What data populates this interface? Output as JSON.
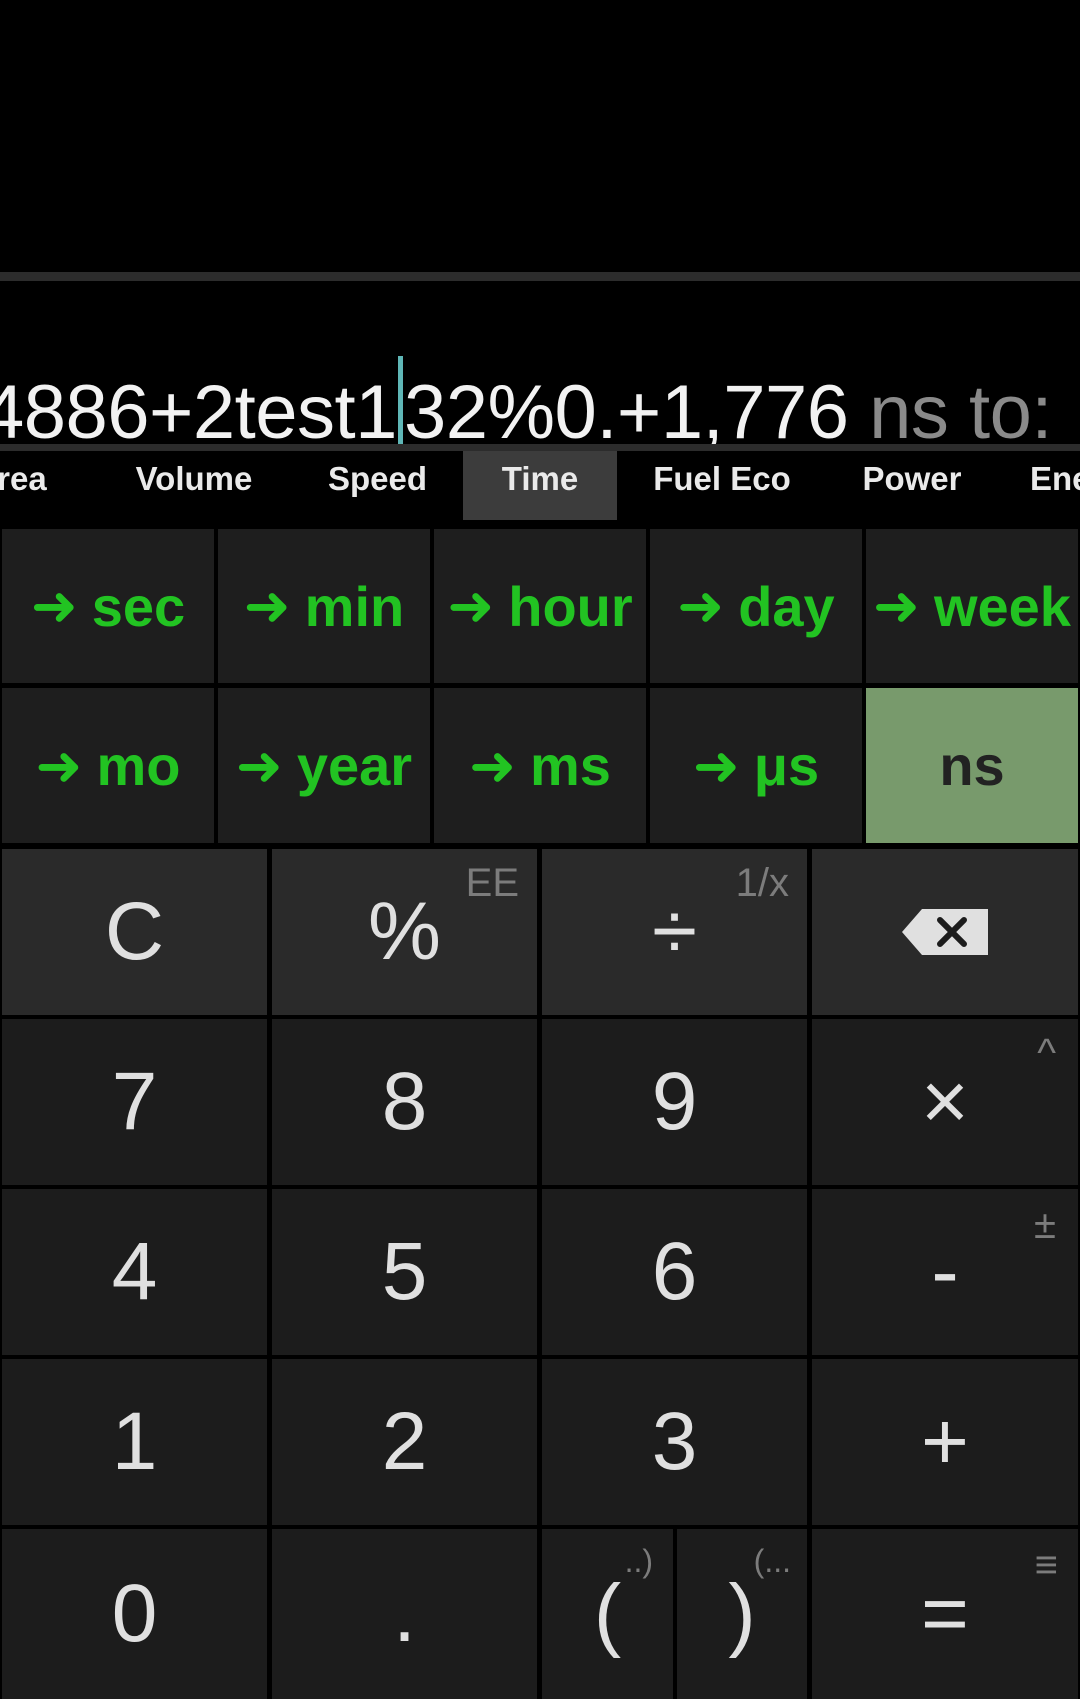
{
  "display": {
    "expression_before_cursor": "4886+2test1",
    "expression_after_cursor": "32%0.+1,776",
    "conversion_suffix": " ns to:"
  },
  "tabs": [
    "Area",
    "Volume",
    "Speed",
    "Time",
    "Fuel Eco",
    "Power",
    "Ene"
  ],
  "active_tab": "Time",
  "units": {
    "arrow": "➜",
    "row1": [
      "sec",
      "min",
      "hour",
      "day",
      "week"
    ],
    "row2": [
      "mo",
      "year",
      "ms",
      "μs"
    ],
    "selected": "ns"
  },
  "keys": {
    "clear": "C",
    "percent": "%",
    "percent_alt": "EE",
    "divide": "÷",
    "divide_alt": "1/x",
    "backspace_icon": "backspace-icon",
    "seven": "7",
    "eight": "8",
    "nine": "9",
    "multiply": "×",
    "multiply_alt": "^",
    "four": "4",
    "five": "5",
    "six": "6",
    "minus": "-",
    "minus_alt": "±",
    "one": "1",
    "two": "2",
    "three": "3",
    "plus": "+",
    "zero": "0",
    "dot": ".",
    "open_paren": "(",
    "open_paren_alt": "..)",
    "close_paren": ")",
    "close_paren_alt": "(...",
    "equals": "=",
    "equals_alt": "≡"
  },
  "colors": {
    "accent_green": "#22c322",
    "selected_unit_bg": "#789a6c",
    "cursor": "#5fb7b7"
  }
}
